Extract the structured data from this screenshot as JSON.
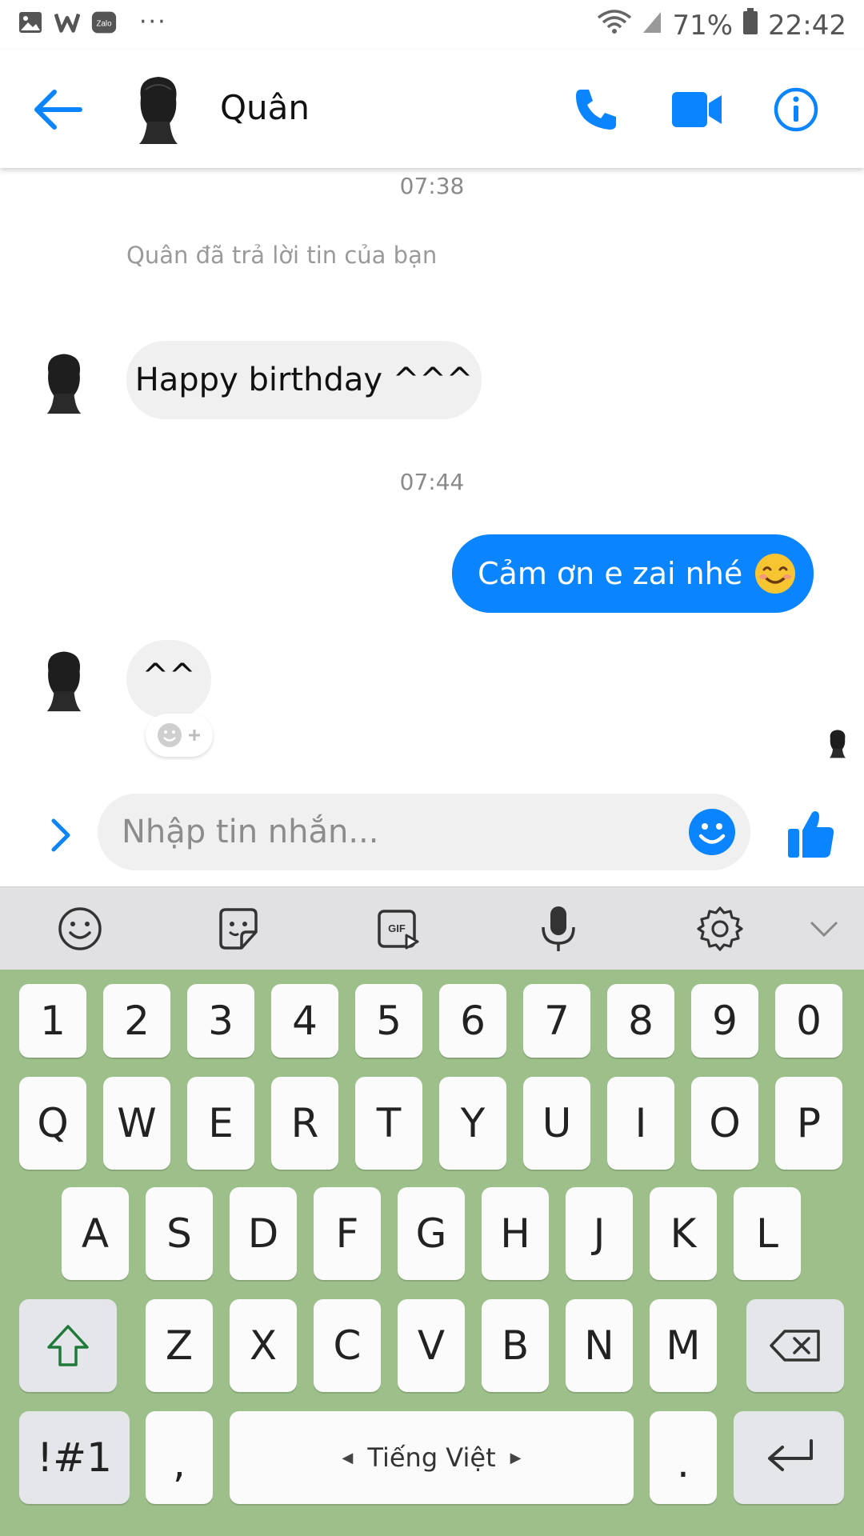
{
  "status_bar": {
    "battery": "71%",
    "time": "22:42",
    "zalo_label": "Zalo",
    "more": "···",
    "left_icons": [
      "gallery-icon",
      "w-app-icon",
      "zalo-icon"
    ],
    "right_icons": [
      "wifi-icon",
      "signal-icon",
      "battery-icon"
    ]
  },
  "header": {
    "contact_name": "Quân",
    "actions": [
      "back-arrow-icon",
      "phone-icon",
      "video-icon",
      "info-icon"
    ]
  },
  "messages": {
    "timestamp_1": "07:38",
    "reply_note": "Quân đã trả lời tin của bạn",
    "incoming_1": "Happy birthday ^^^",
    "timestamp_2": "07:44",
    "outgoing_1": "Cảm ơn e zai nhé",
    "outgoing_1_emoji": "smiling-face-icon",
    "incoming_2": "^^"
  },
  "composer": {
    "placeholder": "Nhập tin nhắn...",
    "value": ""
  },
  "keyboard": {
    "toolbar": [
      "emoji-icon",
      "sticker-icon",
      "gif-icon",
      "microphone-icon",
      "settings-icon",
      "collapse-icon"
    ],
    "gif_label": "GIF",
    "row_numbers": [
      "1",
      "2",
      "3",
      "4",
      "5",
      "6",
      "7",
      "8",
      "9",
      "0"
    ],
    "row_top": [
      "Q",
      "W",
      "E",
      "R",
      "T",
      "Y",
      "U",
      "I",
      "O",
      "P"
    ],
    "row_mid": [
      "A",
      "S",
      "D",
      "F",
      "G",
      "H",
      "J",
      "K",
      "L"
    ],
    "row_bottom": [
      "Z",
      "X",
      "C",
      "V",
      "B",
      "N",
      "M"
    ],
    "symbols_key": "!#1",
    "comma_key": ",",
    "space_label": "Tiếng Việt",
    "period_key": ".",
    "colors": {
      "keyboard_bg": "#9dbf8a",
      "accent": "#0a84ff"
    }
  }
}
